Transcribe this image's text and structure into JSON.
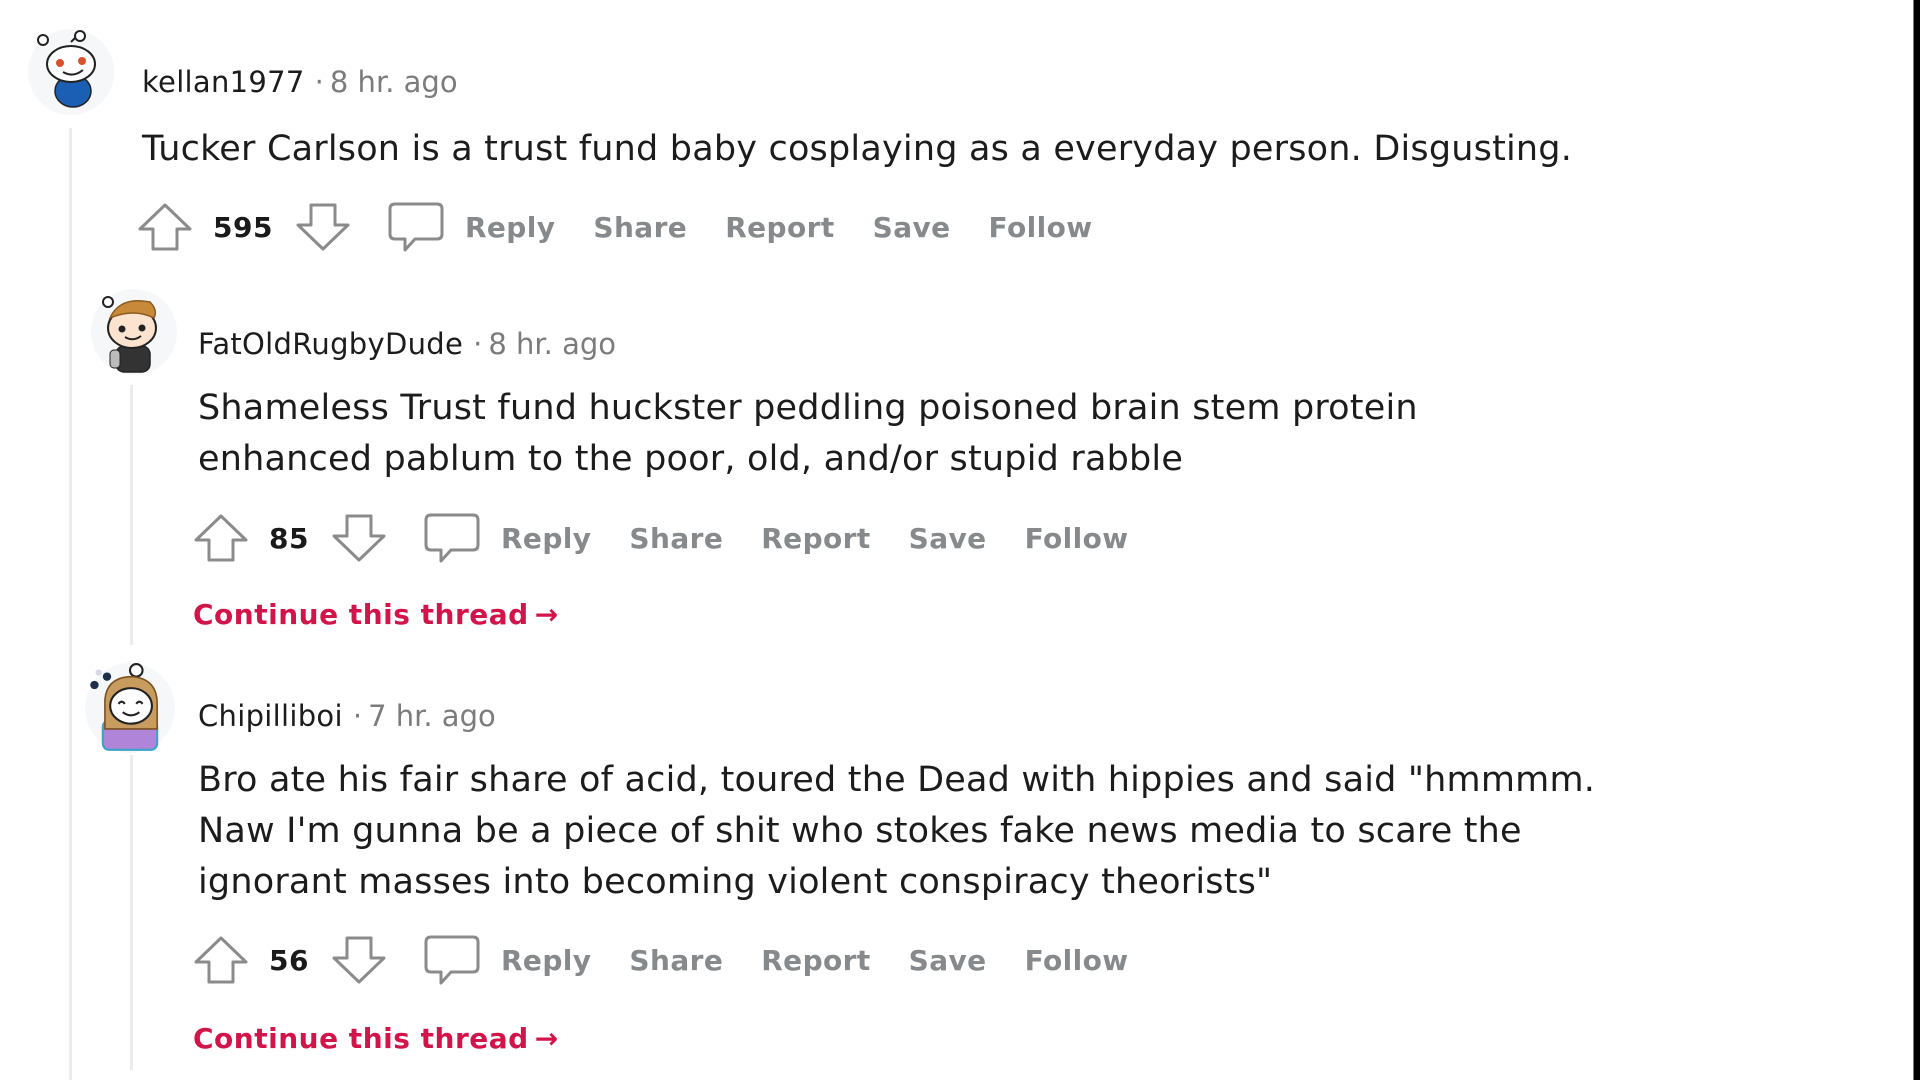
{
  "colors": {
    "continue_link": "#d1154a",
    "action_text": "#878a8c",
    "username": "#1c1c1c",
    "timestamp": "#7c7c7c",
    "thread_line": "#ececec"
  },
  "comments": [
    {
      "avatar_icon": "snoo-avatar-blue-shirt",
      "username": "kellan1977",
      "separator": "·",
      "timestamp": "8 hr. ago",
      "body": [
        "Tucker Carlson is a trust fund baby cosplaying as a everyday person. Disgusting."
      ],
      "score": "595",
      "actions": {
        "reply": "Reply",
        "share": "Share",
        "report": "Report",
        "save": "Save",
        "follow": "Follow"
      }
    },
    {
      "avatar_icon": "snoo-avatar-brown-hair",
      "username": "FatOldRugbyDude",
      "separator": "·",
      "timestamp": "8 hr. ago",
      "body": [
        "Shameless Trust fund huckster peddling poisoned brain stem protein",
        "enhanced pablum to the poor, old, and/or stupid rabble"
      ],
      "score": "85",
      "actions": {
        "reply": "Reply",
        "share": "Share",
        "report": "Report",
        "save": "Save",
        "follow": "Follow"
      },
      "continue_thread": {
        "label": "Continue this thread",
        "arrow": "→"
      }
    },
    {
      "avatar_icon": "snoo-avatar-long-hair",
      "username": "Chipilliboi",
      "separator": "·",
      "timestamp": "7 hr. ago",
      "body": [
        "Bro ate his fair share of acid, toured the Dead with hippies and said \"hmmmm.",
        "Naw I'm gunna be a piece of shit who stokes fake news media to scare the",
        "ignorant masses into becoming violent conspiracy theorists\""
      ],
      "score": "56",
      "actions": {
        "reply": "Reply",
        "share": "Share",
        "report": "Report",
        "save": "Save",
        "follow": "Follow"
      },
      "continue_thread": {
        "label": "Continue this thread",
        "arrow": "→"
      }
    }
  ]
}
